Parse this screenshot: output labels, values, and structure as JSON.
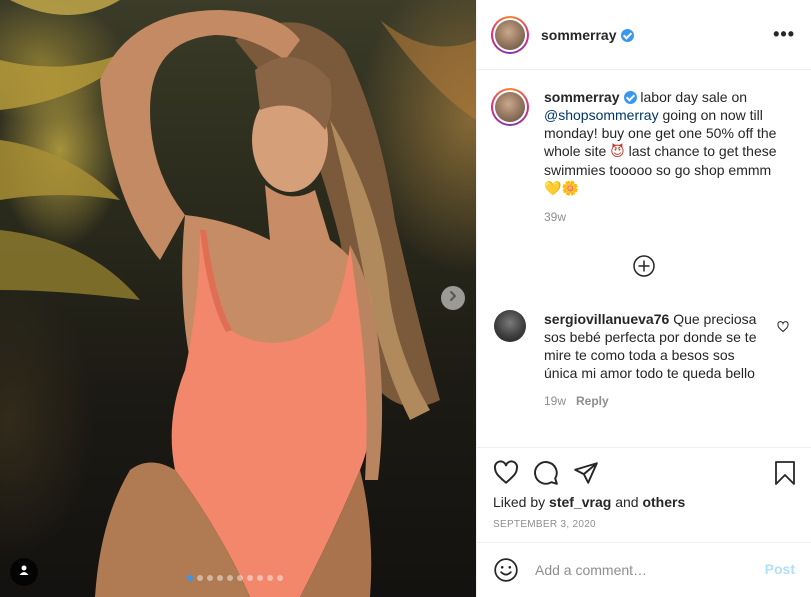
{
  "post": {
    "username": "sommerray",
    "slide_count": 10,
    "active_slide": 1
  },
  "caption": {
    "username": "sommerray",
    "text_before": "labor day sale on",
    "mention": "@shopsommerray",
    "text_after": "going on now till monday! buy one get one 50% off the whole site",
    "emoji_1": "😈",
    "text_end": "last chance to get these swimmies tooooo so go shop emmm",
    "emoji_2": "💛",
    "emoji_3": "🌼",
    "time": "39w"
  },
  "comments": [
    {
      "username": "sergiovillanueva76",
      "text": "Que preciosa sos bebé perfecta por donde se te mire te como toda a besos sos única mi amor todo te queda bello",
      "time": "19w",
      "reply_label": "Reply"
    }
  ],
  "likes": {
    "prefix": "Liked by",
    "user": "stef_vrag",
    "joiner": "and",
    "others": "others"
  },
  "date": "SEPTEMBER 3, 2020",
  "comment_input": {
    "placeholder": "Add a comment…",
    "value": ""
  },
  "post_label": "Post",
  "icons": {
    "more": "more-options-icon",
    "like": "heart-icon",
    "comment": "comment-icon",
    "share": "paper-plane-icon",
    "save": "bookmark-icon",
    "emoji": "smiley-icon",
    "next": "chevron-right-icon",
    "tag": "user-tag-icon",
    "load_more": "plus-circle-icon"
  },
  "colors": {
    "accent": "#3897f0",
    "text": "#262626",
    "muted": "#8e8e8e",
    "post_disabled": "#b2dffc",
    "mention": "#00376b"
  }
}
